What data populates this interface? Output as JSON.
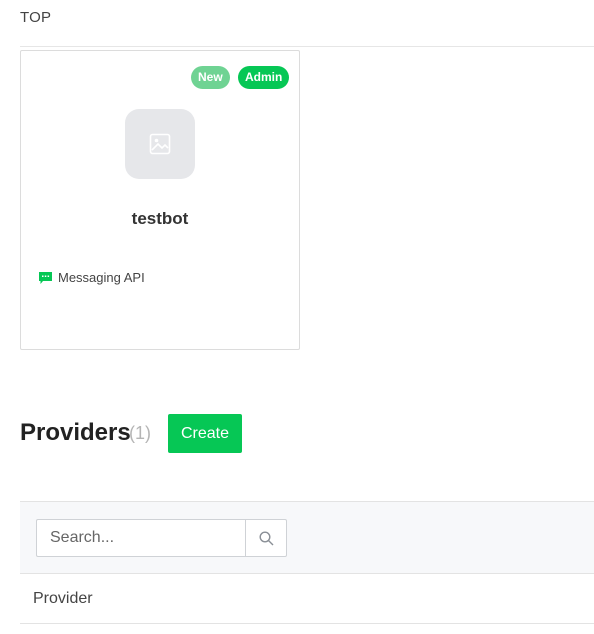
{
  "breadcrumb": {
    "label": "TOP"
  },
  "channel_card": {
    "badges": {
      "new": "New",
      "admin": "Admin"
    },
    "name": "testbot",
    "type_label": "Messaging API",
    "avatar_icon": "image-placeholder-icon",
    "type_icon": "chat-bubble-icon"
  },
  "providers": {
    "title": "Providers",
    "count": "(1)",
    "create_label": "Create"
  },
  "search": {
    "placeholder": "Search...",
    "value": ""
  },
  "table": {
    "columns": [
      "Provider"
    ]
  },
  "colors": {
    "accent": "#06c755",
    "badge_new": "#6fd393",
    "muted": "#b5b5b5"
  }
}
